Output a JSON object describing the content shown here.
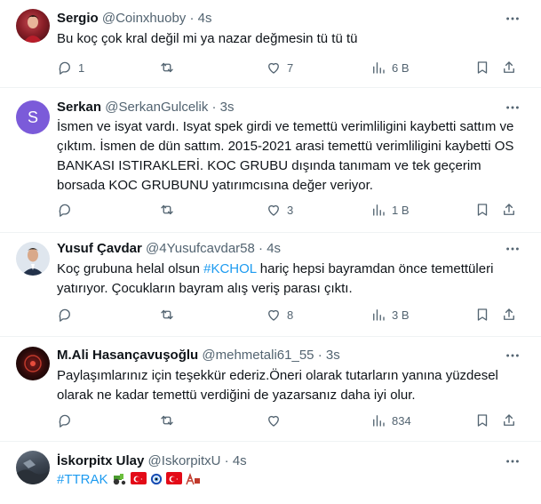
{
  "tweets": [
    {
      "name": "Sergio",
      "handle": "@Coinxhuoby",
      "sep": "·",
      "time": "4s",
      "text": "Bu koç çok kral değil mi ya nazar değmesin tü tü tü",
      "stats": {
        "replies": "1",
        "retweets": "",
        "likes": "7",
        "views": "6 B"
      }
    },
    {
      "name": "Serkan",
      "handle": "@SerkanGulcelik",
      "sep": "·",
      "time": "3s",
      "avatar_letter": "S",
      "text": "İsmen ve isyat vardı. Isyat spek girdi ve temettü verimliligini kaybetti sattım ve çıktım. İsmen de dün sattım. 2015-2021 arasi temettü verimliligini kaybetti OS BANKASI ISTIRAKLERİ. KOC GRUBU dışında tanımam ve tek geçerim borsada KOC GRUBUNU yatırımcısına değer veriyor.",
      "stats": {
        "replies": "",
        "retweets": "",
        "likes": "3",
        "views": "1 B"
      }
    },
    {
      "name": "Yusuf Çavdar",
      "handle": "@4Yusufcavdar58",
      "sep": "·",
      "time": "4s",
      "text_before": "Koç grubuna helal olsun ",
      "hashtag": "#KCHOL",
      "text_after": " hariç hepsi bayramdan önce temettüleri yatırıyor. Çocukların bayram alış veriş parası çıktı.",
      "stats": {
        "replies": "",
        "retweets": "",
        "likes": "8",
        "views": "3 B"
      }
    },
    {
      "name": "M.Ali Hasançavuşoğlu",
      "handle": "@mehmetali61_55",
      "sep": "·",
      "time": "3s",
      "text": "Paylaşımlarınız için teşekkür ederiz.Öneri olarak tutarların yanına yüzdesel olarak ne kadar temettü verdiğini de yazarsanız daha iyi olur.",
      "stats": {
        "replies": "",
        "retweets": "",
        "likes": "",
        "views": "834"
      }
    },
    {
      "name": "İskorpitx Ulay",
      "handle": "@IskorpitxU",
      "sep": "·",
      "time": "4s",
      "hashtag": "#TTRAK",
      "emoji_names": [
        "tractor-emoji",
        "turkey-flag-emoji",
        "nazar-emoji",
        "turkey-flag-emoji",
        "oil-derrick-emoji"
      ]
    }
  ],
  "colors": {
    "text": "#0f1419",
    "secondary": "#536471",
    "link": "#1d9bf0",
    "divider": "#eff3f4",
    "serkan_avatar": "#7b5bd9"
  },
  "icons": [
    "more-icon",
    "reply-icon",
    "retweet-icon",
    "like-icon",
    "views-icon",
    "bookmark-icon",
    "share-icon"
  ]
}
